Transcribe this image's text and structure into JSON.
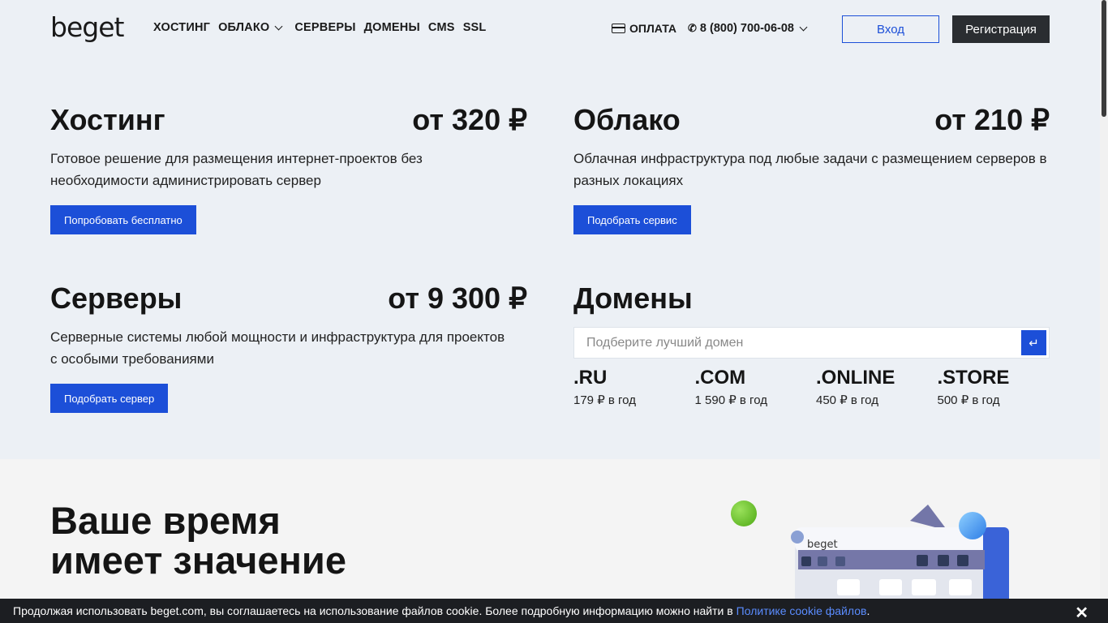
{
  "header": {
    "logo": "beget",
    "nav": [
      {
        "label": "ХОСТИНГ",
        "dropdown": false
      },
      {
        "label": "ОБЛАКО",
        "dropdown": true
      },
      {
        "label": "СЕРВЕРЫ",
        "dropdown": false
      },
      {
        "label": "ДОМЕНЫ",
        "dropdown": false
      },
      {
        "label": "CMS",
        "dropdown": false
      },
      {
        "label": "SSL",
        "dropdown": false
      }
    ],
    "payment": "ОПЛАТА",
    "phone": "8 (800) 700-06-08",
    "login": "Вход",
    "register": "Регистрация"
  },
  "products": {
    "hosting": {
      "title": "Хостинг",
      "price": "от 320 ₽",
      "description": "Готовое решение для размещения интернет-проектов без необходимости администрировать сервер",
      "button": "Попробовать бесплатно"
    },
    "cloud": {
      "title": "Облако",
      "price": "от 210 ₽",
      "description": "Облачная инфраструктура под любые задачи с размещением серверов в разных локациях",
      "button": "Подобрать сервис"
    },
    "servers": {
      "title": "Серверы",
      "price": "от 9 300 ₽",
      "description": "Серверные системы любой мощности и инфраструктура для проектов с особыми требованиями",
      "button": "Подобрать сервер"
    },
    "domains": {
      "title": "Домены",
      "search_placeholder": "Подберите лучший домен",
      "zones": [
        {
          "name": ".RU",
          "price": "179 ₽ в год"
        },
        {
          "name": ".COM",
          "price": "1 590 ₽ в год"
        },
        {
          "name": ".ONLINE",
          "price": "450 ₽ в год"
        },
        {
          "name": ".STORE",
          "price": "500 ₽ в год"
        }
      ]
    }
  },
  "hero": {
    "line1": "Ваше время",
    "line2": "имеет значение",
    "illustration_logo": "beget"
  },
  "cookie": {
    "text": "Продолжая использовать beget.com, вы соглашаетесь на использование файлов cookie. Более подробную информацию можно найти в",
    "link": "Политике cookie файлов",
    "tail": "."
  },
  "colors": {
    "accent": "#1c4fd8",
    "dark_button": "#2a2d31",
    "top_background": "#ecf0f5",
    "cookie_background": "#1c1e22"
  },
  "icons": [
    "card-icon",
    "phone-icon",
    "chevron-down-icon",
    "enter-icon",
    "close-icon"
  ]
}
